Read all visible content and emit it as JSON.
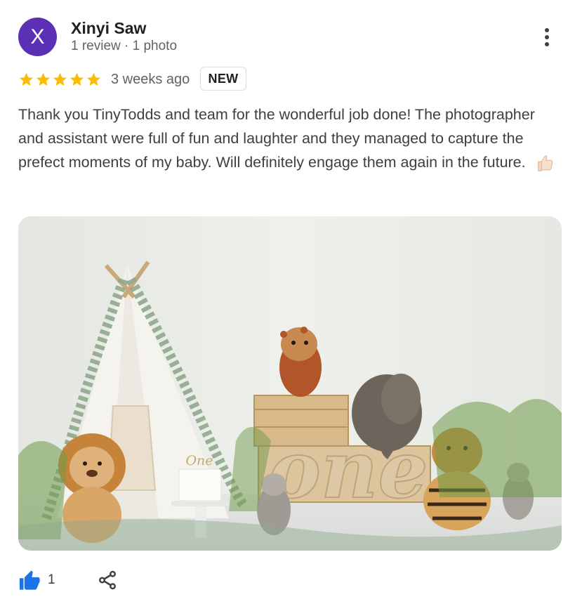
{
  "reviewer": {
    "initial": "X",
    "name": "Xinyi Saw",
    "meta": "1 review · 1 photo",
    "avatar_color": "#5b30b5"
  },
  "menu_icon": "more-vert-icon",
  "rating": {
    "stars": 5,
    "star_color": "#fbbc04",
    "time_ago": "3 weeks ago",
    "badge": "NEW"
  },
  "review_text": "Thank you TinyTodds and team for the wonderful job done! The photographer and assistant were full of fun and laughter and they managed to capture the prefect moments of my baby. Will definitely engage them again in the future.",
  "review_emoji": "thumbs-up-emoji",
  "photo": {
    "icon": "review-photo",
    "topper_text": "One",
    "sign_text": "one"
  },
  "actions": {
    "like_icon": "thumbs-up-icon",
    "like_count": "1",
    "like_color": "#1a73e8",
    "share_icon": "share-icon"
  }
}
